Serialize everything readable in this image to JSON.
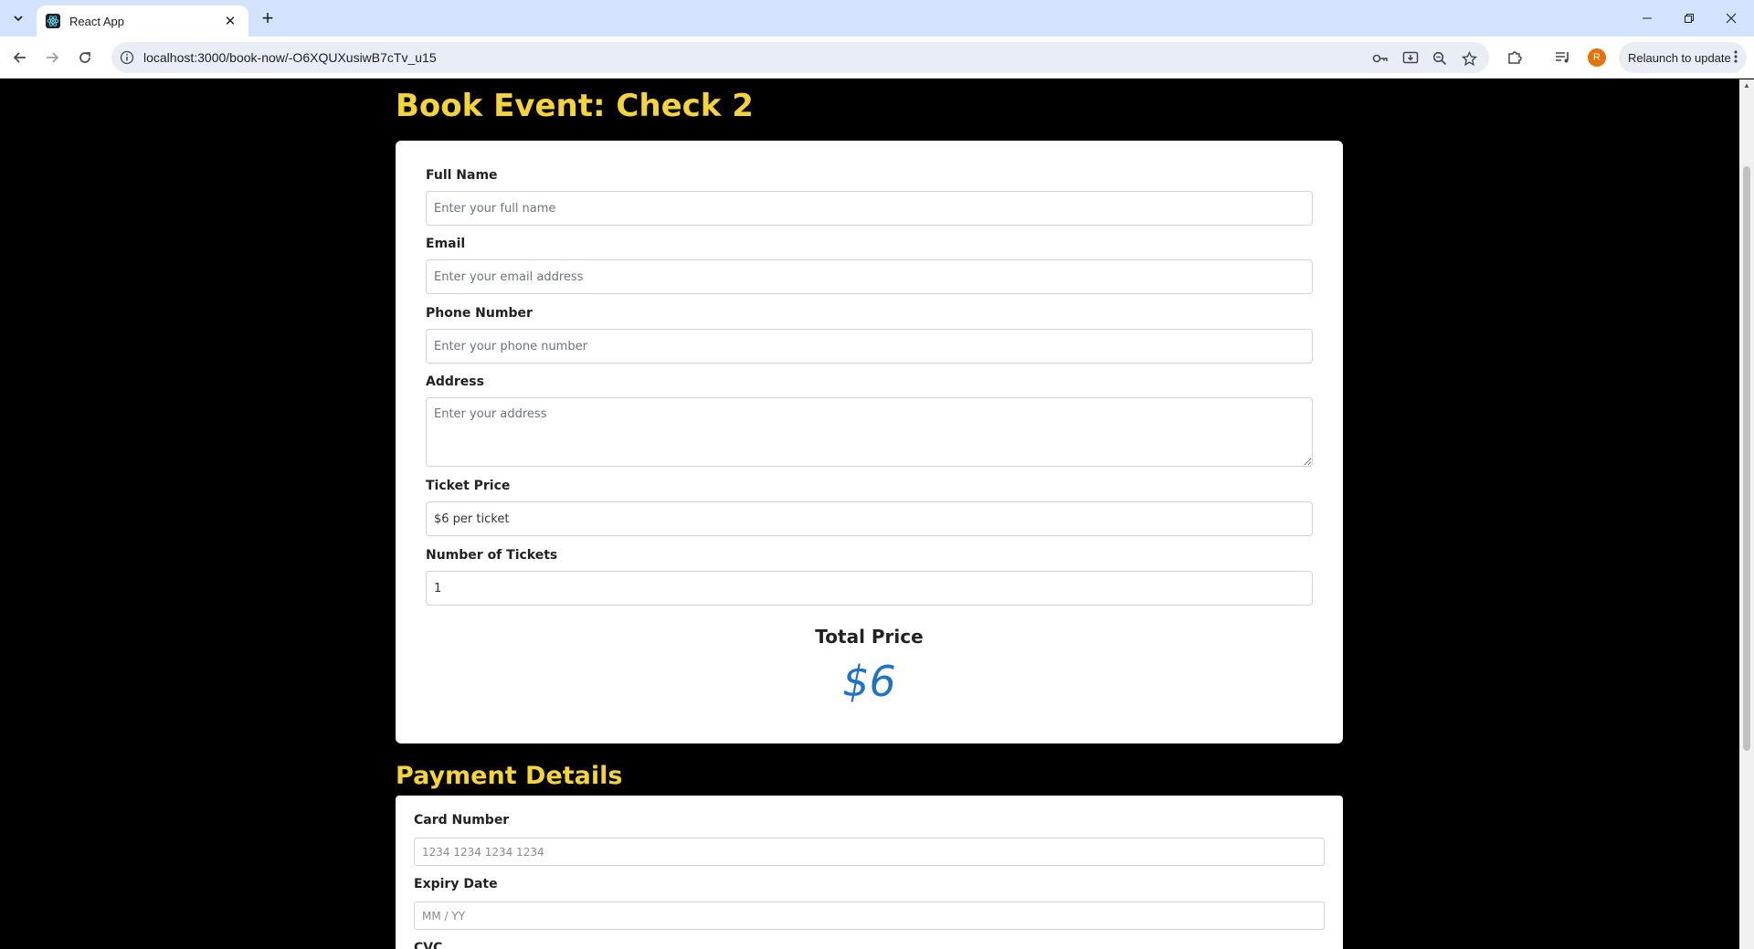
{
  "browser": {
    "tab_title": "React App",
    "url": "localhost:3000/book-now/-O6XQUXusiwB7cTv_u15",
    "profile_initial": "R",
    "relaunch_label": "Relaunch to update"
  },
  "page": {
    "title": "Book Event: Check 2"
  },
  "booking_form": {
    "full_name": {
      "label": "Full Name",
      "placeholder": "Enter your full name",
      "value": ""
    },
    "email": {
      "label": "Email",
      "placeholder": "Enter your email address",
      "value": ""
    },
    "phone": {
      "label": "Phone Number",
      "placeholder": "Enter your phone number",
      "value": ""
    },
    "address": {
      "label": "Address",
      "placeholder": "Enter your address",
      "value": ""
    },
    "ticket_price": {
      "label": "Ticket Price",
      "value": "$6 per ticket"
    },
    "num_tickets": {
      "label": "Number of Tickets",
      "value": "1"
    },
    "total_label": "Total Price",
    "total_value": "$6"
  },
  "payment": {
    "title": "Payment Details",
    "card_number": {
      "label": "Card Number",
      "placeholder": "1234 1234 1234 1234"
    },
    "expiry": {
      "label": "Expiry Date",
      "placeholder": "MM / YY"
    },
    "cvc": {
      "label": "CVC"
    }
  }
}
